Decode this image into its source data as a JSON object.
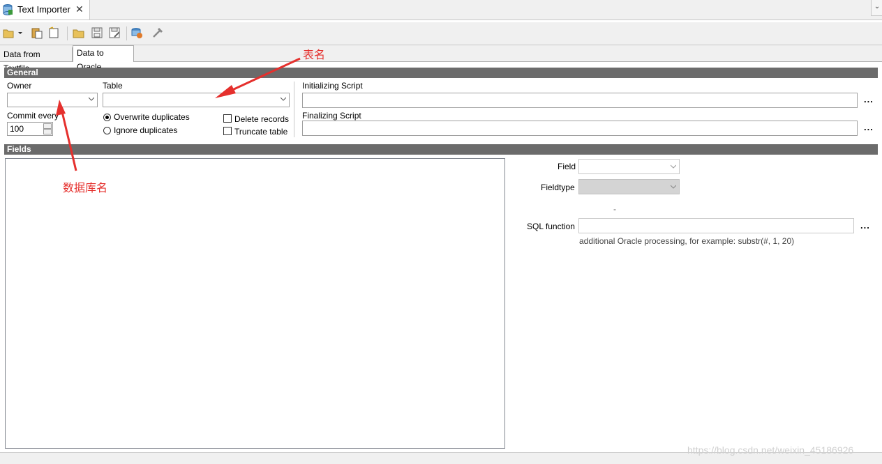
{
  "editor_tab": {
    "title": "Text Importer",
    "close_glyph": "✕"
  },
  "view_menu_glyph": "⌄",
  "toolbar": {
    "icons": [
      "open-menu-icon",
      "paste-icon",
      "new-icon",
      "open-folder-icon",
      "save-icon",
      "save-as-icon",
      "run-import-icon",
      "settings-icon"
    ]
  },
  "page_tabs": {
    "tab1": "Data from Textfile",
    "tab2": "Data to Oracle"
  },
  "general": {
    "header": "General",
    "owner_label": "Owner",
    "owner_value": "",
    "table_label": "Table",
    "table_value": "",
    "commit_label": "Commit every",
    "commit_value": "100",
    "overwrite_label": "Overwrite duplicates",
    "ignore_label": "Ignore duplicates",
    "delete_label": "Delete records",
    "truncate_label": "Truncate table",
    "init_script_label": "Initializing Script",
    "final_script_label": "Finalizing Script",
    "ellipsis": "..."
  },
  "fields": {
    "header": "Fields",
    "field_label": "Field",
    "fieldtype_label": "Fieldtype",
    "dash": "-",
    "sql_function_label": "SQL function",
    "sql_hint": "additional Oracle processing, for example: substr(#, 1, 20)"
  },
  "annotations": {
    "table_name": "表名",
    "database_name": "数据库名"
  },
  "watermark": "https://blog.csdn.net/weixin_45186926",
  "colors": {
    "section_header": "#6b6b6b",
    "annotation": "#e5302d"
  }
}
